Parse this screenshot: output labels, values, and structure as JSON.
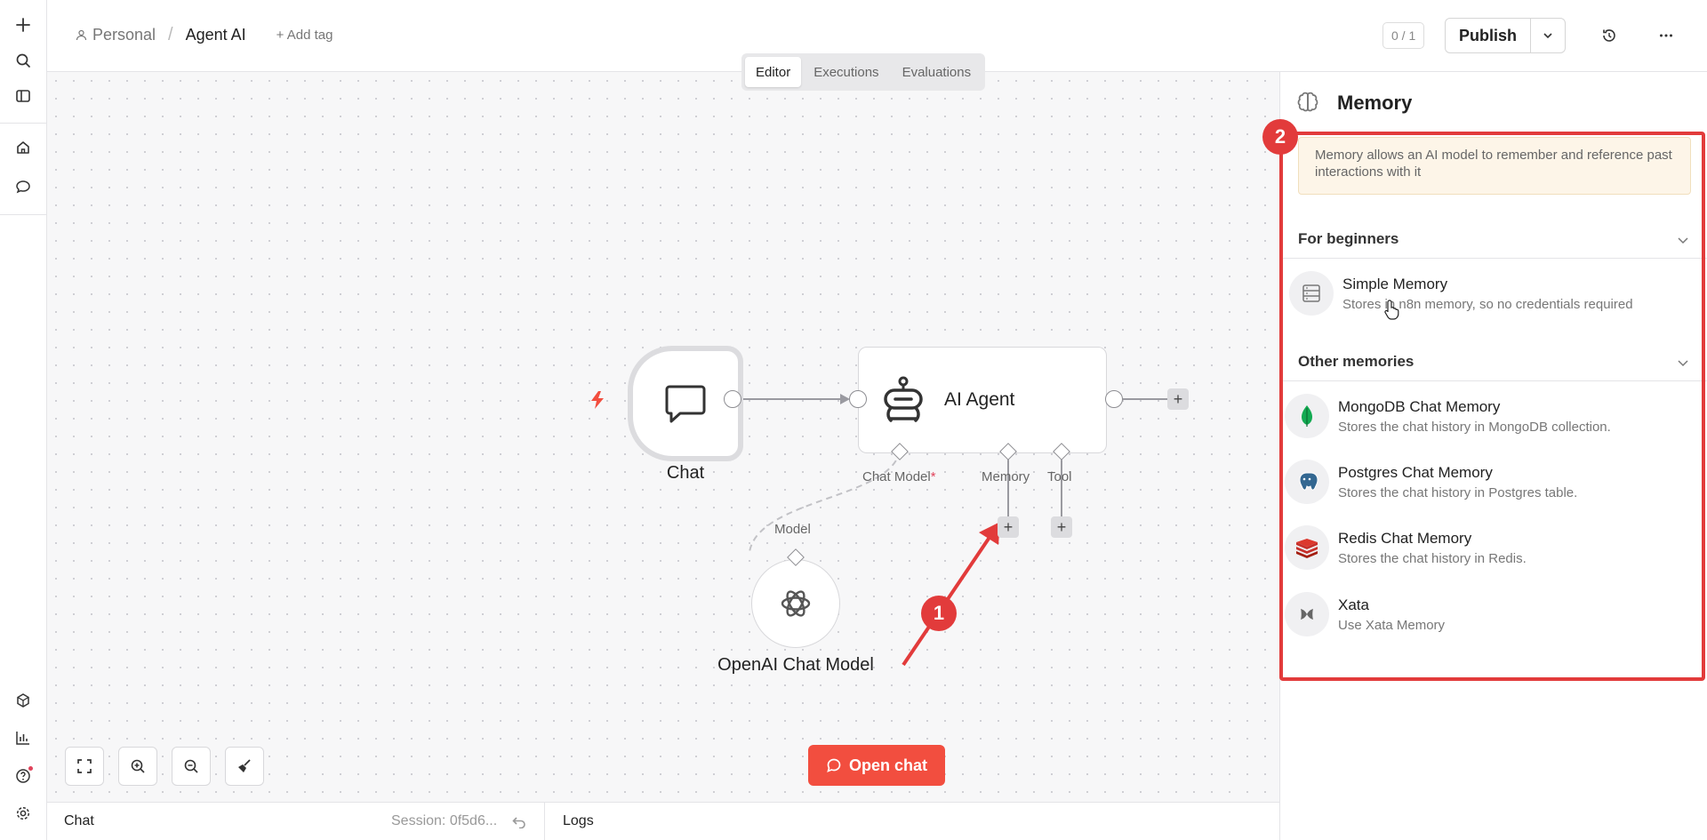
{
  "header": {
    "breadcrumb_personal": "Personal",
    "breadcrumb_sep": "/",
    "workflow_name": "Agent AI",
    "add_tag": "+ Add tag",
    "counter": "0 / 1",
    "publish_label": "Publish"
  },
  "view_tabs": [
    {
      "label": "Editor",
      "active": true
    },
    {
      "label": "Executions",
      "active": false
    },
    {
      "label": "Evaluations",
      "active": false
    }
  ],
  "canvas": {
    "nodes": {
      "chat": "Chat",
      "agent": "AI Agent",
      "openai": "OpenAI Chat Model"
    },
    "connectors": {
      "chat_model": "Chat Model",
      "required_mark": "*",
      "memory": "Memory",
      "tool": "Tool",
      "model": "Model"
    },
    "plus": "+",
    "open_chat": "Open chat",
    "badge_1": "1",
    "badge_2": "2"
  },
  "bottom_bar": {
    "chat": "Chat",
    "session": "Session: 0f5d6...",
    "logs": "Logs"
  },
  "panel": {
    "title": "Memory",
    "info": "Memory allows an AI model to remember and reference past interactions with it",
    "sections": [
      {
        "title": "For beginners",
        "items": [
          {
            "title": "Simple Memory",
            "desc": "Stores in n8n memory, so no credentials required",
            "icon": "database-icon"
          }
        ]
      },
      {
        "title": "Other memories",
        "items": [
          {
            "title": "MongoDB Chat Memory",
            "desc": "Stores the chat history in MongoDB collection.",
            "icon": "mongodb-icon"
          },
          {
            "title": "Postgres Chat Memory",
            "desc": "Stores the chat history in Postgres table.",
            "icon": "postgres-icon"
          },
          {
            "title": "Redis Chat Memory",
            "desc": "Stores the chat history in Redis.",
            "icon": "redis-icon"
          },
          {
            "title": "Xata",
            "desc": "Use Xata Memory",
            "icon": "xata-icon"
          }
        ]
      }
    ]
  },
  "colors": {
    "accent": "#f24e3f",
    "highlight": "#e23b3b",
    "info_bg": "#fdf5e8"
  }
}
